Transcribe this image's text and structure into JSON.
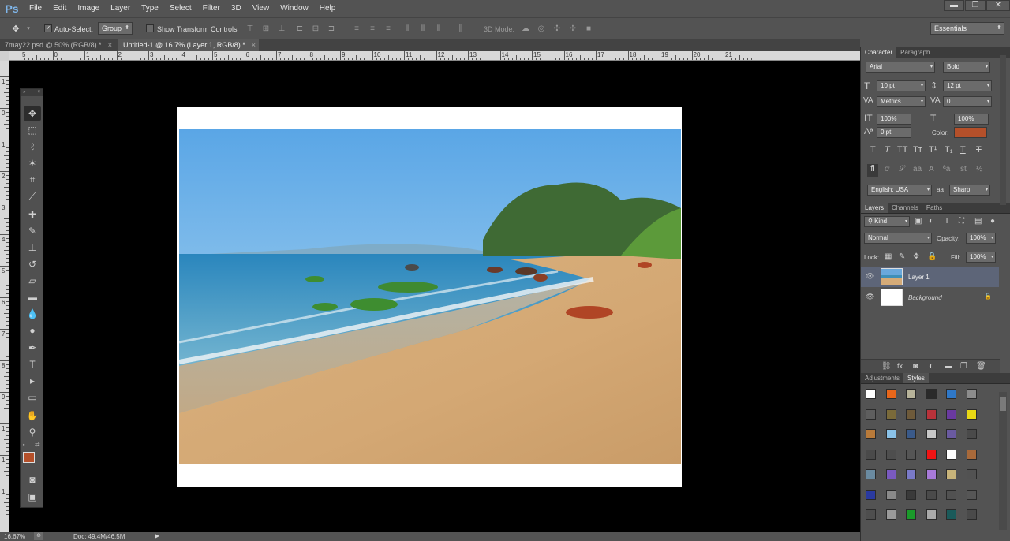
{
  "app": {
    "logo": "Ps"
  },
  "menu": [
    "File",
    "Edit",
    "Image",
    "Layer",
    "Type",
    "Select",
    "Filter",
    "3D",
    "View",
    "Window",
    "Help"
  ],
  "window_controls": {
    "minimize": "▬",
    "restore": "❐",
    "close": "✕"
  },
  "options": {
    "auto_select_label": "Auto-Select:",
    "auto_select_value": "Group",
    "show_transform_label": "Show Transform Controls",
    "mode_3d_label": "3D Mode:",
    "workspace": "Essentials"
  },
  "tabs": [
    {
      "label": "7may22.psd @ 50% (RGB/8) *",
      "active": false
    },
    {
      "label": "Untitled-1 @ 16.7% (Layer 1, RGB/8) *",
      "active": true
    }
  ],
  "ruler_top": [
    "5",
    "0",
    "1",
    "2",
    "3",
    "4",
    "5",
    "6",
    "7",
    "8",
    "9",
    "10",
    "11",
    "12",
    "13",
    "14",
    "15",
    "16",
    "17",
    "18",
    "19",
    "20",
    "21"
  ],
  "ruler_left": [
    "1",
    "0",
    "1",
    "2",
    "3",
    "4",
    "5",
    "6",
    "7",
    "8",
    "9",
    "1",
    "1",
    "1"
  ],
  "character": {
    "tabs": [
      "Character",
      "Paragraph"
    ],
    "font_family": "Arial",
    "font_style": "Bold",
    "size": "10 pt",
    "leading": "12 pt",
    "kerning": "Metrics",
    "tracking": "0",
    "vscale": "100%",
    "hscale": "100%",
    "baseline": "0 pt",
    "color_label": "Color:",
    "color": "#b5502a",
    "language": "English: USA",
    "aa_label": "aa",
    "antialias": "Sharp"
  },
  "layers": {
    "tabs": [
      "Layers",
      "Channels",
      "Paths"
    ],
    "kind": "Kind",
    "blend": "Normal",
    "opacity_label": "Opacity:",
    "opacity": "100%",
    "lock_label": "Lock:",
    "fill_label": "Fill:",
    "fill": "100%",
    "items": [
      {
        "name": "Layer 1",
        "selected": true
      },
      {
        "name": "Background",
        "selected": false
      }
    ]
  },
  "styles": {
    "tabs": [
      "Adjustments",
      "Styles"
    ]
  },
  "tool_colors": {
    "foreground": "#b5502a",
    "background": "#1e7fd0"
  },
  "status": {
    "zoom": "16.67%",
    "doc": "Doc: 49.4M/46.5M"
  }
}
